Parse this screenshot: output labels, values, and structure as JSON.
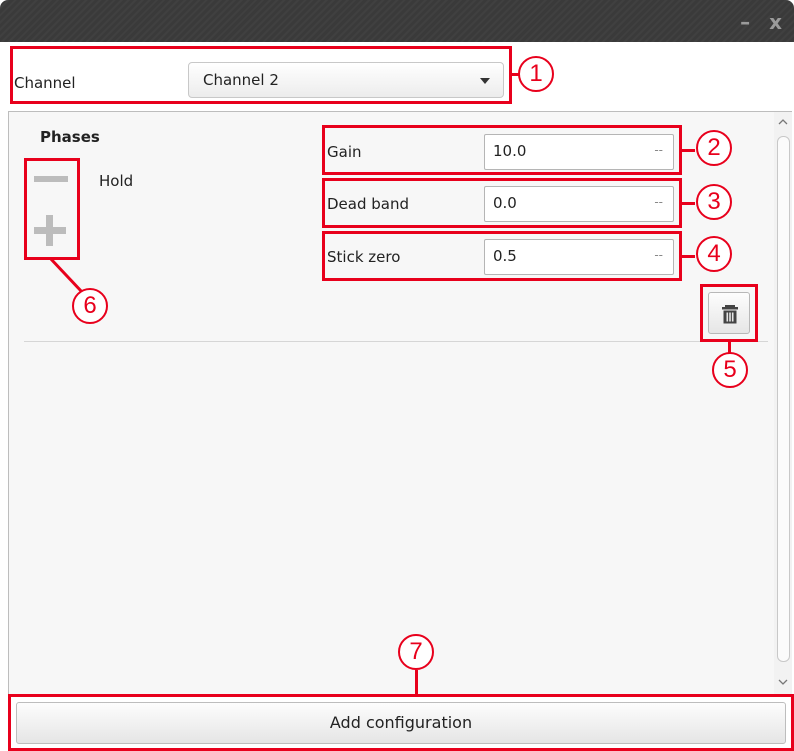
{
  "window": {
    "controls": "– x"
  },
  "channel": {
    "label": "Channel",
    "selected": "Channel 2"
  },
  "phases": {
    "title": "Phases",
    "items": [
      "Hold"
    ]
  },
  "fields": [
    {
      "label": "Gain",
      "value": "10.0",
      "unit": "--"
    },
    {
      "label": "Dead band",
      "value": "0.0",
      "unit": "--"
    },
    {
      "label": "Stick zero",
      "value": "0.5",
      "unit": "--"
    }
  ],
  "actions": {
    "add_configuration": "Add configuration"
  },
  "callouts": [
    "1",
    "2",
    "3",
    "4",
    "5",
    "6",
    "7"
  ],
  "icons": {
    "dropdown": "chevron-down-icon",
    "remove": "minus-icon",
    "add": "plus-icon",
    "delete": "trash-icon"
  },
  "colors": {
    "annotation": "#e8001c",
    "titlebar": "#3a3a3a"
  }
}
